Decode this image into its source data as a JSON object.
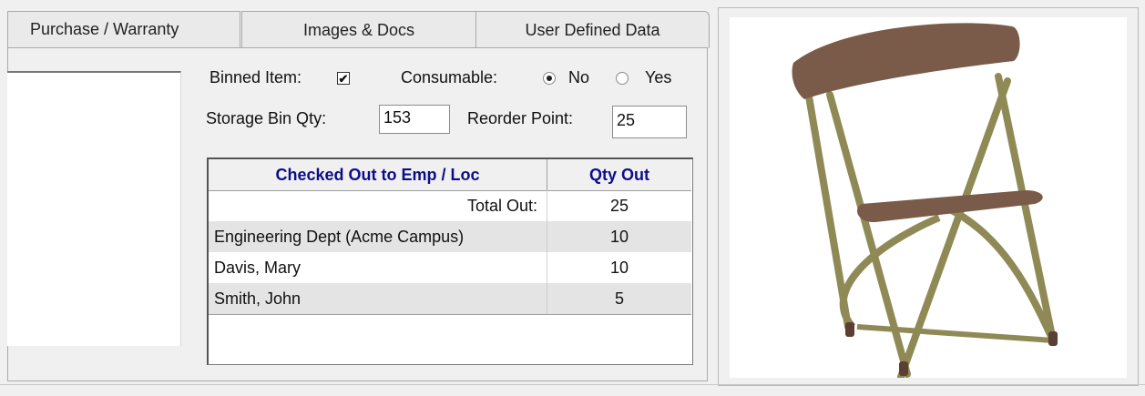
{
  "tabs": [
    {
      "label": "Purchase / Warranty"
    },
    {
      "label": "Images & Docs"
    },
    {
      "label": "User Defined Data"
    }
  ],
  "binned": {
    "label": "Binned Item:",
    "checked": true,
    "check_glyph": "✔"
  },
  "consumable": {
    "label": "Consumable:",
    "options": [
      "No",
      "Yes"
    ],
    "selected": "No"
  },
  "storage_bin_qty": {
    "label": "Storage Bin Qty:",
    "value": "153"
  },
  "reorder_point": {
    "label": "Reorder Point:",
    "value": "25"
  },
  "checkout_table": {
    "headers": {
      "name": "Checked Out to Emp / Loc",
      "qty": "Qty Out"
    },
    "total": {
      "label": "Total Out:",
      "value": "25"
    },
    "rows": [
      {
        "name": "Engineering Dept (Acme Campus)",
        "qty": "10"
      },
      {
        "name": "Davis, Mary",
        "qty": "10"
      },
      {
        "name": "Smith, John",
        "qty": "5"
      }
    ]
  },
  "image": {
    "icon": "folding-chair-image"
  },
  "colors": {
    "header_text": "#0d0d8c",
    "alt_row": "#e4e4e4",
    "chair_seat": "#7a5a48",
    "chair_frame": "#8f8a55"
  }
}
